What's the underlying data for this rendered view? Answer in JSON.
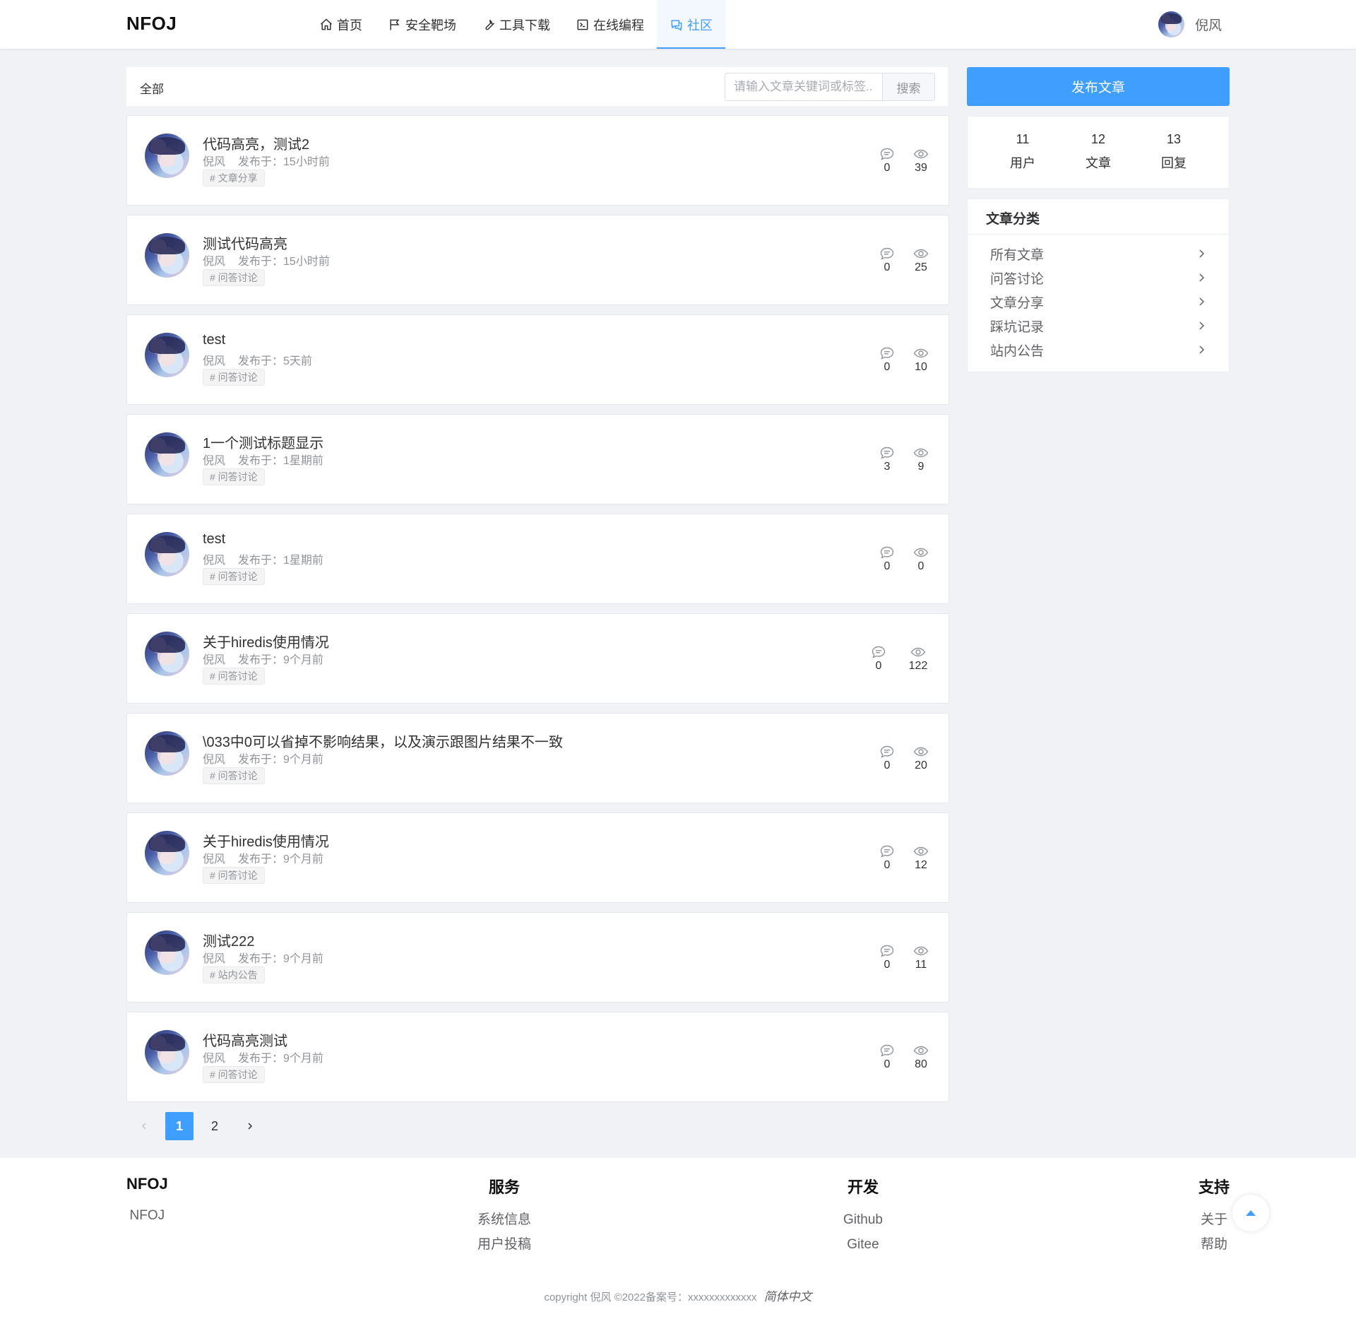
{
  "header": {
    "logo": "NFOJ",
    "nav": [
      {
        "label": "首页",
        "icon": "home-icon"
      },
      {
        "label": "安全靶场",
        "icon": "flag-icon"
      },
      {
        "label": "工具下载",
        "icon": "wrench-icon"
      },
      {
        "label": "在线编程",
        "icon": "terminal-icon"
      },
      {
        "label": "社区",
        "icon": "chat-icon",
        "active": true
      }
    ],
    "username": "倪风"
  },
  "filter": {
    "label": "全部",
    "search_placeholder": "请输入文章关键词或标签...",
    "search_button": "搜索"
  },
  "posts": [
    {
      "title": "代码高亮，测试2",
      "author": "倪风",
      "time": "发布于：15小时前",
      "tag": "# 文章分享",
      "comments": "0",
      "views": "39"
    },
    {
      "title": "测试代码高亮",
      "author": "倪风",
      "time": "发布于：15小时前",
      "tag": "# 问答讨论",
      "comments": "0",
      "views": "25"
    },
    {
      "title": "test",
      "author": "倪风",
      "time": "发布于：5天前",
      "tag": "# 问答讨论",
      "comments": "0",
      "views": "10"
    },
    {
      "title": "1一个测试标题显示",
      "author": "倪风",
      "time": "发布于：1星期前",
      "tag": "# 问答讨论",
      "comments": "3",
      "views": "9"
    },
    {
      "title": "test",
      "author": "倪风",
      "time": "发布于：1星期前",
      "tag": "# 问答讨论",
      "comments": "0",
      "views": "0"
    },
    {
      "title": "关于hiredis使用情况",
      "author": "倪风",
      "time": "发布于：9个月前",
      "tag": "# 问答讨论",
      "comments": "0",
      "views": "122"
    },
    {
      "title": "\\033中0可以省掉不影响结果，以及演示跟图片结果不一致",
      "author": "倪风",
      "time": "发布于：9个月前",
      "tag": "# 问答讨论",
      "comments": "0",
      "views": "20"
    },
    {
      "title": "关于hiredis使用情况",
      "author": "倪风",
      "time": "发布于：9个月前",
      "tag": "# 问答讨论",
      "comments": "0",
      "views": "12"
    },
    {
      "title": "测试222",
      "author": "倪风",
      "time": "发布于：9个月前",
      "tag": "# 站内公告",
      "comments": "0",
      "views": "11"
    },
    {
      "title": "代码高亮测试",
      "author": "倪风",
      "time": "发布于：9个月前",
      "tag": "# 问答讨论",
      "comments": "0",
      "views": "80"
    }
  ],
  "pagination": {
    "pages": [
      "1",
      "2"
    ],
    "current": "1"
  },
  "sidebar": {
    "publish_button": "发布文章",
    "counts": [
      {
        "num": "11",
        "label": "用户"
      },
      {
        "num": "12",
        "label": "文章"
      },
      {
        "num": "13",
        "label": "回复"
      }
    ],
    "categories_title": "文章分类",
    "categories": [
      "所有文章",
      "问答讨论",
      "文章分享",
      "踩坑记录",
      "站内公告"
    ]
  },
  "footer": {
    "col1": {
      "title": "NFOJ",
      "links": [
        "NFOJ"
      ]
    },
    "col2": {
      "title": "服务",
      "links": [
        "系统信息",
        "用户投稿"
      ]
    },
    "col3": {
      "title": "开发",
      "links": [
        "Github",
        "Gitee"
      ]
    },
    "col4": {
      "title": "支持",
      "links": [
        "关于",
        "帮助"
      ]
    },
    "copyright": "copyright 倪风 ©2022备案号：xxxxxxxxxxxxx",
    "language": "简体中文"
  },
  "colors": {
    "accent": "#409eff",
    "background": "#f0f2f5"
  }
}
